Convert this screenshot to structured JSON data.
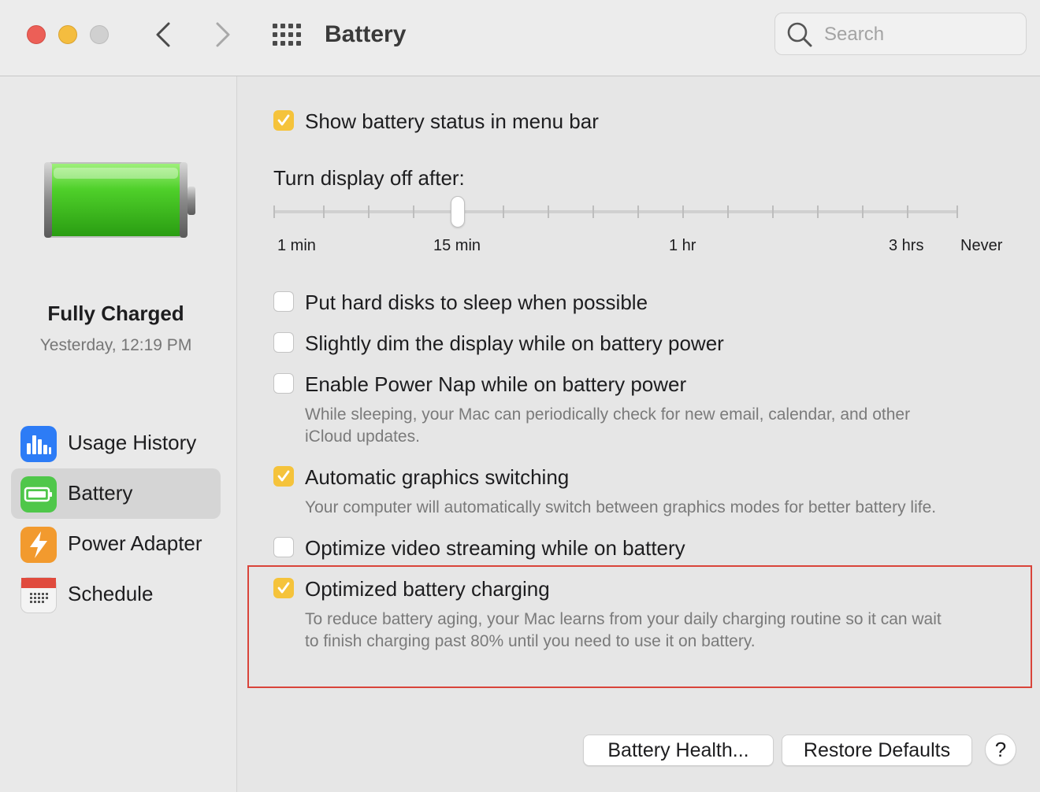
{
  "window": {
    "title": "Battery",
    "search_placeholder": "Search"
  },
  "status": {
    "title": "Fully Charged",
    "time": "Yesterday, 12:19 PM"
  },
  "sidebar": {
    "items": [
      {
        "label": "Usage History",
        "icon": "bar-chart-icon",
        "color": "#2d7cf6"
      },
      {
        "label": "Battery",
        "icon": "battery-icon",
        "color": "#4fc74a",
        "selected": true
      },
      {
        "label": "Power Adapter",
        "icon": "lightning-icon",
        "color": "#f29a2e"
      },
      {
        "label": "Schedule",
        "icon": "calendar-icon",
        "color": "#e04a3d"
      }
    ]
  },
  "options": {
    "show_status": {
      "label": "Show battery status in menu bar",
      "checked": true
    },
    "hard_disks": {
      "label": "Put hard disks to sleep when possible",
      "checked": false
    },
    "dim_display": {
      "label": "Slightly dim the display while on battery power",
      "checked": false
    },
    "power_nap": {
      "label": "Enable Power Nap while on battery power",
      "checked": false,
      "desc_line1": "While sleeping, your Mac can periodically check for new email, calendar, and other",
      "desc_line2": "iCloud updates."
    },
    "graphics": {
      "label": "Automatic graphics switching",
      "checked": true,
      "desc": "Your computer will automatically switch between graphics modes for better battery life."
    },
    "video": {
      "label": "Optimize video streaming while on battery",
      "checked": false
    },
    "optimized_charging": {
      "label": "Optimized battery charging",
      "checked": true,
      "desc_line1": "To reduce battery aging, your Mac learns from your daily charging routine so it can wait",
      "desc_line2": "to finish charging past 80% until you need to use it on battery."
    }
  },
  "display_slider": {
    "label": "Turn display off after:",
    "value": "15 min",
    "tick_labels": [
      "1 min",
      "15 min",
      "1 hr",
      "3 hrs",
      "Never"
    ]
  },
  "buttons": {
    "battery_health": "Battery Health...",
    "restore_defaults": "Restore Defaults",
    "help": "?"
  },
  "colors": {
    "checkbox_accent": "#f5c33b",
    "highlight_border": "#d9443a",
    "battery_fill": "#4fd02a"
  }
}
